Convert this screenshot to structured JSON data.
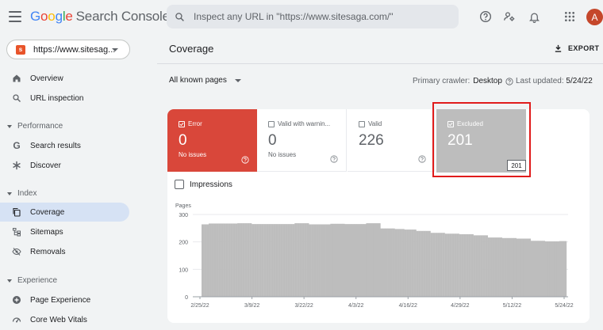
{
  "header": {
    "logo_google": [
      "G",
      "o",
      "o",
      "g",
      "l",
      "e"
    ],
    "logo_product": "Search Console",
    "search_placeholder": "Inspect any URL in \"https://www.sitesaga.com/\"",
    "avatar_letter": "A"
  },
  "sidebar": {
    "property": "https://www.sitesag...",
    "overview": "Overview",
    "url_inspection": "URL inspection",
    "performance": "Performance",
    "search_results": "Search results",
    "discover": "Discover",
    "index": "Index",
    "coverage": "Coverage",
    "sitemaps": "Sitemaps",
    "removals": "Removals",
    "experience": "Experience",
    "page_experience": "Page Experience",
    "core_web_vitals": "Core Web Vitals"
  },
  "main": {
    "title": "Coverage",
    "export_label": "EXPORT",
    "filter": "All known pages",
    "crawler_label": "Primary crawler:",
    "crawler_value": "Desktop",
    "updated_label": "Last updated:",
    "updated_value": "5/24/22",
    "tiles": {
      "error": {
        "label": "Error",
        "value": "0",
        "sub": "No issues"
      },
      "warn": {
        "label": "Valid with warnin...",
        "value": "0",
        "sub": "No issues"
      },
      "valid": {
        "label": "Valid",
        "value": "226"
      },
      "excluded": {
        "label": "Excluded",
        "value": "201"
      }
    },
    "tooltip_value": "201",
    "impressions_label": "Impressions"
  },
  "colors": {
    "error": "#d9473a",
    "excluded": "#bdbdbd",
    "highlight": "#e01b1b",
    "active_nav": "#d6e2f4"
  },
  "chart_data": {
    "type": "bar",
    "ylabel": "Pages",
    "ylim": [
      0,
      300
    ],
    "yticks": [
      "0",
      "100",
      "200",
      "300"
    ],
    "xticks": [
      "2/25/22",
      "3/9/22",
      "3/22/22",
      "4/3/22",
      "4/16/22",
      "4/29/22",
      "5/12/22",
      "5/24/22"
    ],
    "series": [
      {
        "color": "#bdbdbd",
        "values": [
          264,
          264,
          264,
          267,
          267,
          267,
          267,
          267,
          267,
          267,
          267,
          267,
          267,
          267,
          267,
          268,
          268,
          268,
          268,
          268,
          268,
          265,
          265,
          265,
          265,
          265,
          265,
          265,
          265,
          265,
          265,
          265,
          265,
          265,
          265,
          265,
          265,
          265,
          265,
          268,
          268,
          268,
          268,
          268,
          268,
          264,
          264,
          264,
          264,
          264,
          264,
          264,
          264,
          264,
          266,
          266,
          266,
          266,
          266,
          266,
          265,
          265,
          265,
          265,
          265,
          265,
          265,
          265,
          265,
          268,
          268,
          268,
          268,
          268,
          268,
          249,
          249,
          249,
          249,
          249,
          249,
          247,
          247,
          247,
          247,
          245,
          245,
          245,
          245,
          245,
          240,
          240,
          240,
          240,
          240,
          240,
          233,
          233,
          233,
          233,
          233,
          233,
          230,
          230,
          230,
          230,
          230,
          230,
          228,
          228,
          228,
          228,
          228,
          228,
          224,
          224,
          224,
          224,
          224,
          224,
          216,
          216,
          216,
          216,
          216,
          216,
          214,
          214,
          214,
          214,
          214,
          214,
          212,
          212,
          212,
          212,
          212,
          212,
          204,
          204,
          204,
          204,
          204,
          204,
          202,
          202,
          202,
          202,
          202,
          202,
          203,
          203,
          203
        ]
      }
    ]
  }
}
